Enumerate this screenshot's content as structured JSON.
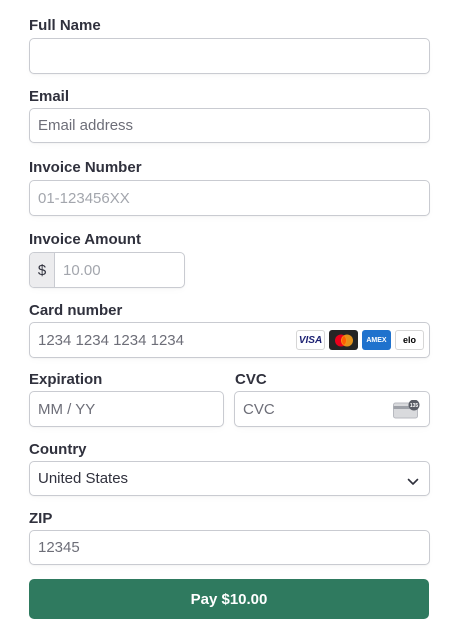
{
  "full_name": {
    "label": "Full Name",
    "value": "",
    "placeholder": ""
  },
  "email": {
    "label": "Email",
    "value": "",
    "placeholder": "Email address"
  },
  "invoice_number": {
    "label": "Invoice Number",
    "value": "",
    "placeholder": "01-123456XX"
  },
  "invoice_amount": {
    "label": "Invoice Amount",
    "currency_symbol": "$",
    "value": "",
    "placeholder": "10.00"
  },
  "card_number": {
    "label": "Card number",
    "value": "",
    "placeholder": "1234 1234 1234 1234",
    "brands": [
      {
        "name": "visa-icon",
        "text": "VISA"
      },
      {
        "name": "mastercard-icon",
        "text": ""
      },
      {
        "name": "amex-icon",
        "text": "AMEX"
      },
      {
        "name": "elo-icon",
        "text": "elo"
      }
    ]
  },
  "expiration": {
    "label": "Expiration",
    "value": "",
    "placeholder": "MM / YY"
  },
  "cvc": {
    "label": "CVC",
    "value": "",
    "placeholder": "CVC",
    "icon_text": "135"
  },
  "country": {
    "label": "Country",
    "selected": "United States"
  },
  "zip": {
    "label": "ZIP",
    "value": "",
    "placeholder": "12345"
  },
  "pay_button": {
    "label": "Pay $10.00"
  },
  "colors": {
    "button": "#2f7a5f",
    "border": "#c9cbd1",
    "text": "#30313d"
  }
}
